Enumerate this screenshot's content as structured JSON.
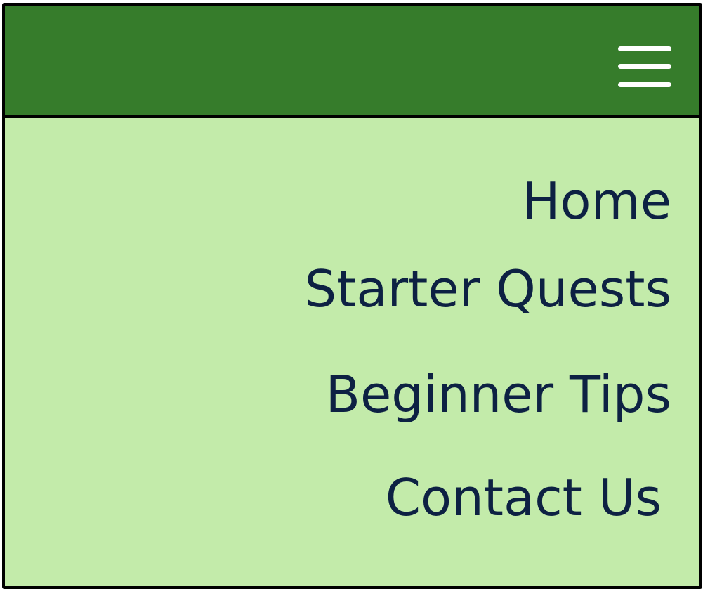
{
  "header": {
    "background_color": "#367c2b",
    "menu_icon": "hamburger-menu-icon"
  },
  "nav": {
    "background_color": "#c3ebaa",
    "text_color": "#0d2143",
    "items": [
      {
        "label": "Home"
      },
      {
        "label": "Starter Quests"
      },
      {
        "label": "Beginner Tips"
      },
      {
        "label": "Contact Us"
      }
    ]
  }
}
